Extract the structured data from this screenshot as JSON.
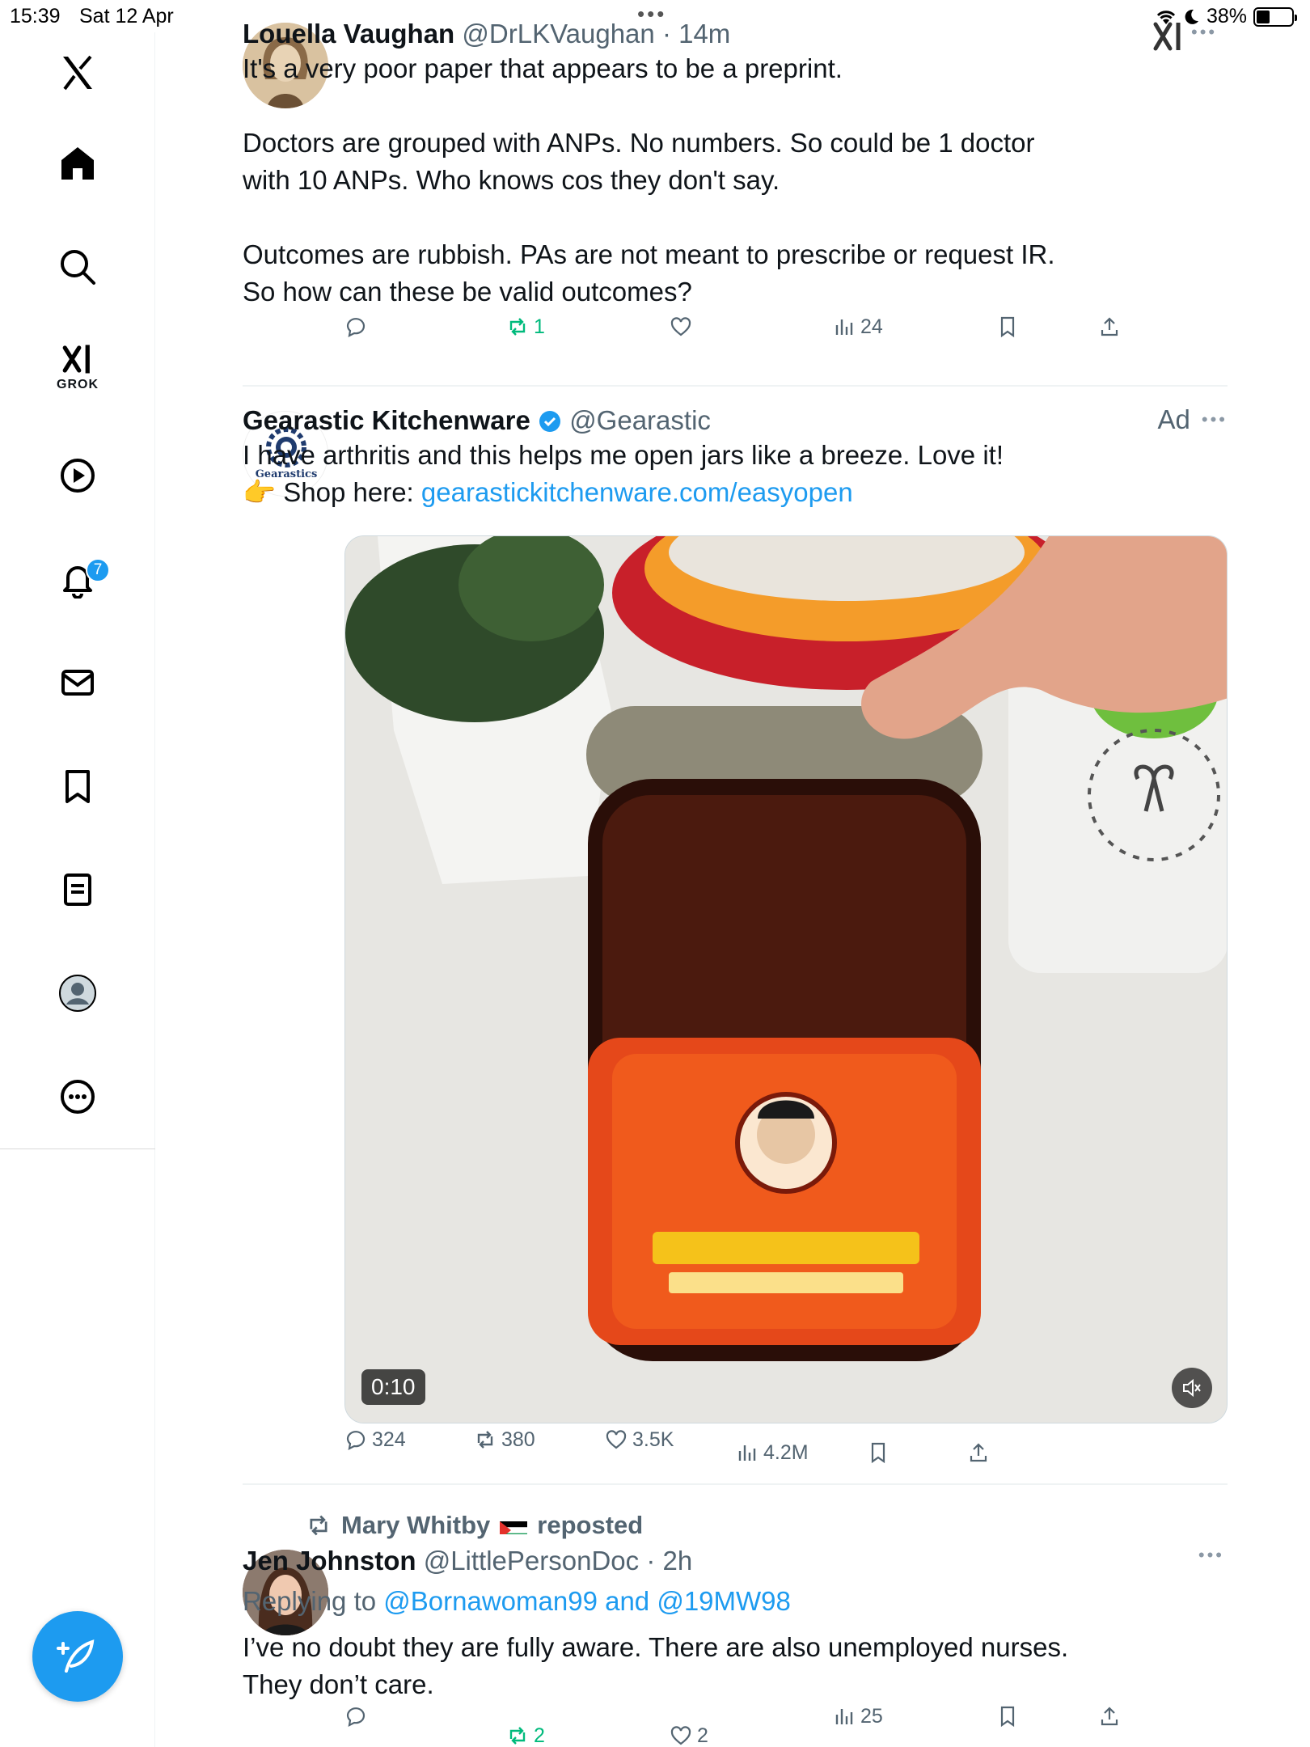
{
  "status_bar": {
    "time": "15:39",
    "date": "Sat 12 Apr",
    "battery": "38%",
    "battery_level": 0.38
  },
  "sidebar": {
    "items": [
      {
        "name": "logo",
        "icon": "x-logo-icon"
      },
      {
        "name": "home",
        "icon": "home-icon"
      },
      {
        "name": "explore",
        "icon": "search-icon"
      },
      {
        "name": "grok",
        "icon": "grok-icon",
        "label": "GROK"
      },
      {
        "name": "videos",
        "icon": "play-circle-icon"
      },
      {
        "name": "notifications",
        "icon": "bell-icon",
        "badge": "7"
      },
      {
        "name": "messages",
        "icon": "mail-icon"
      },
      {
        "name": "bookmarks",
        "icon": "bookmark-icon"
      },
      {
        "name": "lists",
        "icon": "list-icon"
      },
      {
        "name": "profile",
        "icon": "avatar-icon"
      },
      {
        "name": "more",
        "icon": "more-circle-icon"
      }
    ]
  },
  "top_right": {
    "brand": "xI",
    "more": "•••"
  },
  "posts": [
    {
      "name": "Louella Vaughan",
      "handle": "@DrLKVaughan",
      "time": "· 14m",
      "text_lines": [
        "It's a very poor paper that appears to be a preprint.",
        "",
        "Doctors are grouped with ANPs. No numbers. So could be 1 doctor",
        "with 10 ANPs. Who knows cos they don't say.",
        "",
        "Outcomes are rubbish. PAs are not meant to prescribe or request IR.",
        "So how can these be valid outcomes?"
      ],
      "replies": "",
      "reposts": "1",
      "likes": "",
      "views": "24"
    },
    {
      "name": "Gearastic Kitchenware",
      "handle": "@Gearastic",
      "ad": "Ad",
      "avatar_text": "Gearastics",
      "text_line1": "I have arthritis and this helps me open jars like a breeze. Love it!",
      "text_line2_emoji": "👉",
      "text_line2_prefix": "Shop here:",
      "link": "gearastickitchenware.com/easyopen",
      "video_time": "0:10",
      "replies": "324",
      "reposts": "380",
      "likes": "3.5K",
      "views": "4.2M"
    },
    {
      "reposted_by": "Mary Whitby",
      "reposted_suffix": "reposted",
      "name": "Jen Johnston",
      "handle": "@LittlePersonDoc",
      "time": "· 2h",
      "replying_prefix": "Replying to",
      "replying_to": "@Bornawoman99 and @19MW98",
      "text_lines": [
        "I’ve no doubt they are fully aware. There are also unemployed nurses.",
        "They don’t care."
      ],
      "replies": "",
      "reposts": "2",
      "likes": "2",
      "views": "25"
    }
  ],
  "colors": {
    "accent": "#1d9bf0",
    "repost_green": "#00ba7c",
    "muted": "#536471",
    "text": "#0f1419"
  }
}
